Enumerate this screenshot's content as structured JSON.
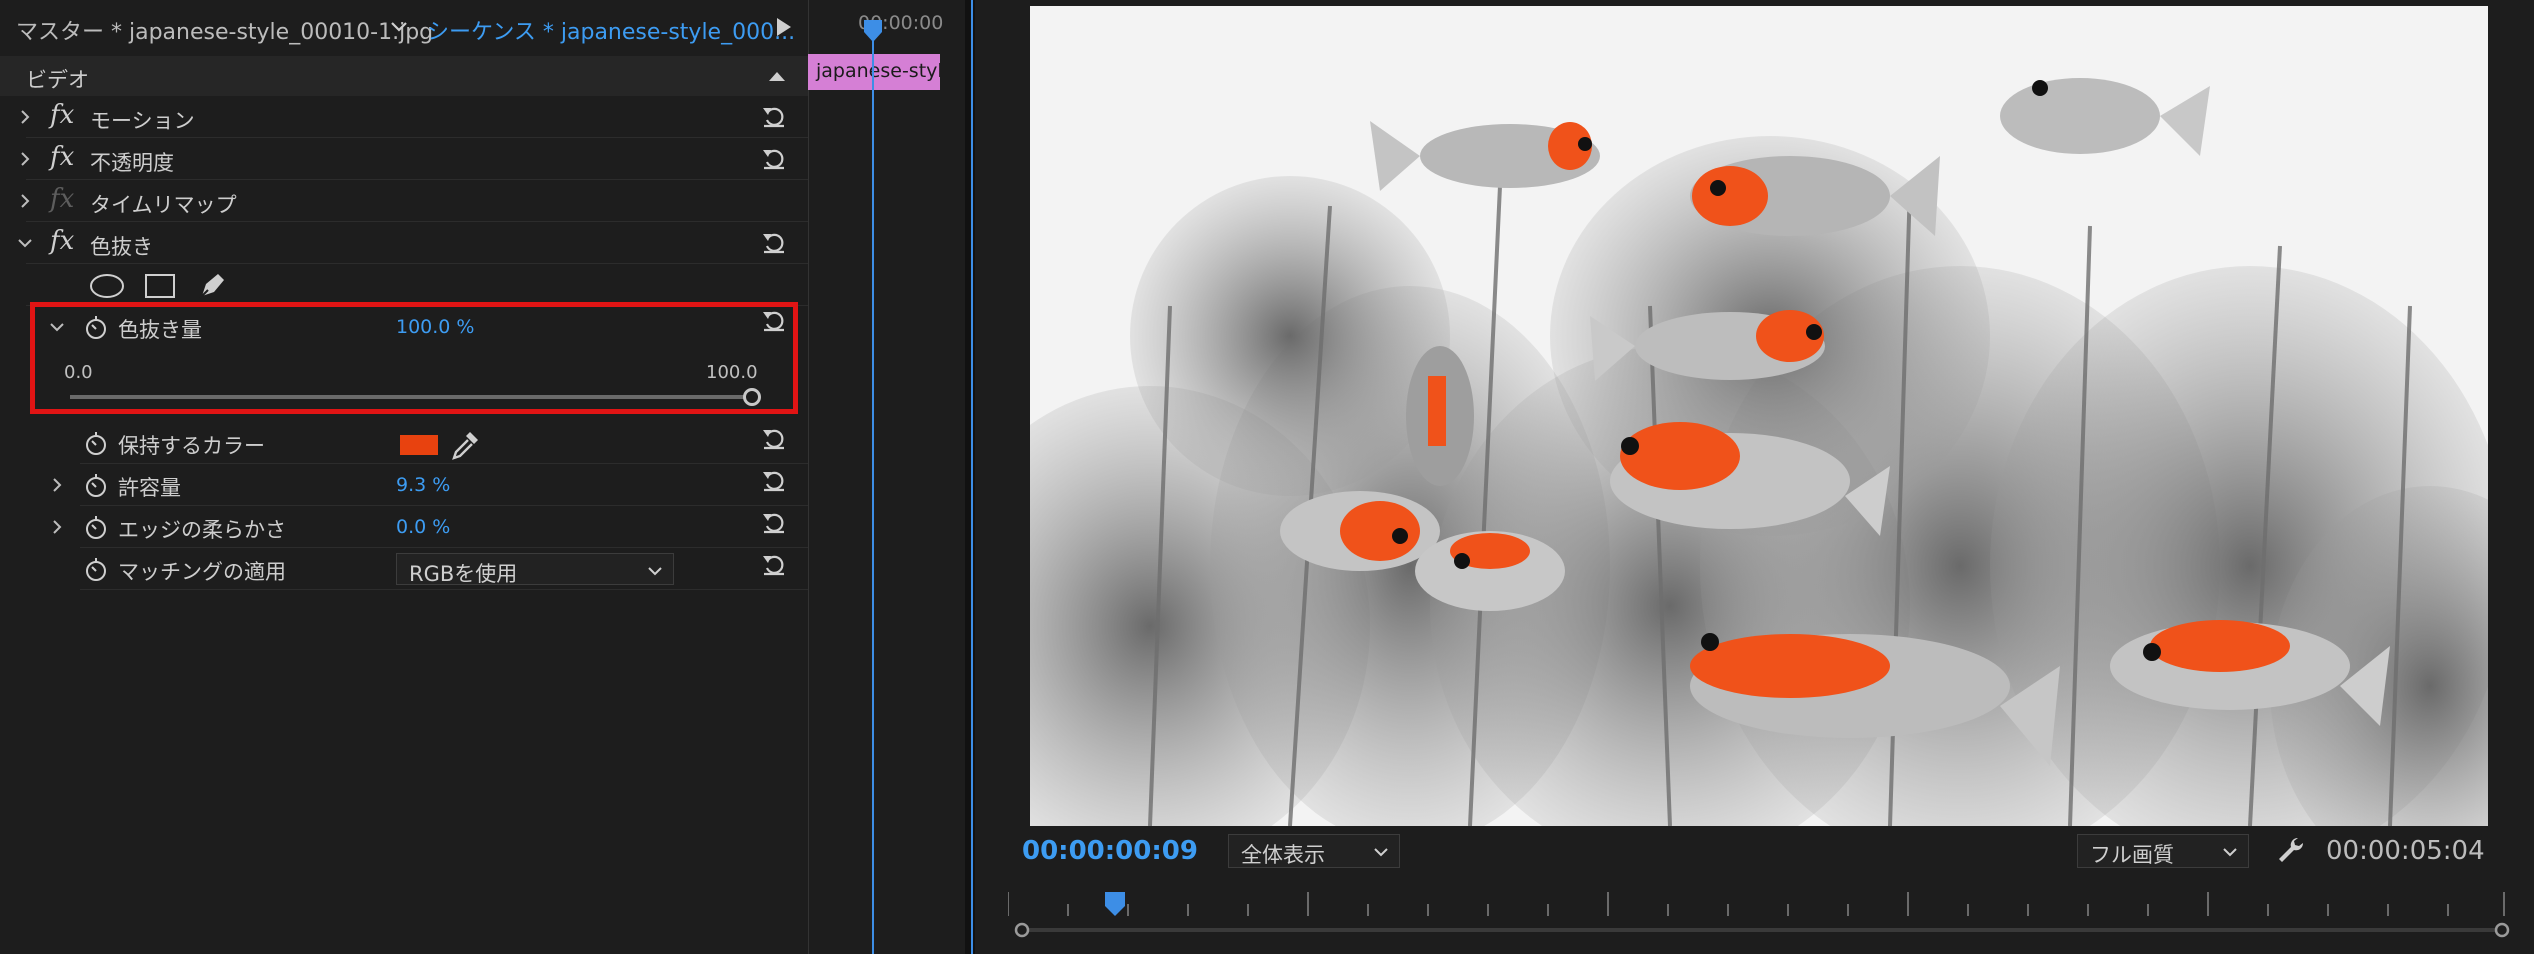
{
  "effect_controls": {
    "tab_master": "マスター * japanese-style_00010-1.jpg",
    "tab_sequence": "シーケンス * japanese-style_000...",
    "section_video": "ビデオ",
    "effects": [
      {
        "label": "モーション"
      },
      {
        "label": "不透明度"
      },
      {
        "label": "タイムリマップ"
      },
      {
        "label": "色抜き"
      }
    ],
    "params": {
      "amount": {
        "label": "色抜き量",
        "value": "100.0 %",
        "min": "0.0",
        "max": "100.0",
        "level": 1.0
      },
      "keep_color": {
        "label": "保持するカラー",
        "color": "#e8420f"
      },
      "tolerance": {
        "label": "許容量",
        "value": "9.3 %"
      },
      "edge_softness": {
        "label": "エッジの柔らかさ",
        "value": "0.0 %"
      },
      "match": {
        "label": "マッチングの適用",
        "value": "RGBを使用"
      }
    },
    "mini_timeline": {
      "timecode": "00:00:00",
      "clip_label": "japanese-style"
    }
  },
  "program_monitor": {
    "current_time": "00:00:00:09",
    "zoom_option": "全体表示",
    "quality_option": "フル画質",
    "duration": "00:00:05:04",
    "accent": "#3d9cf2",
    "image": {
      "description_icon": "goldfish-image"
    }
  }
}
